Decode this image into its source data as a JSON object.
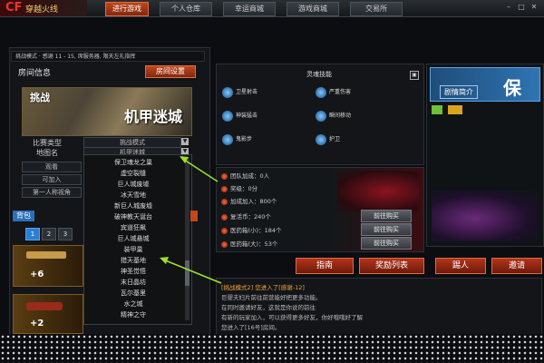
{
  "app": {
    "logo_short": "CF",
    "logo_text": "穿越火线"
  },
  "nav": {
    "tabs": [
      {
        "label": "进行游戏",
        "active": true
      },
      {
        "label": "个人仓库",
        "active": false
      },
      {
        "label": "幸运商城",
        "active": false
      },
      {
        "label": "游戏商城",
        "active": false
      },
      {
        "label": "交易所",
        "active": false
      }
    ]
  },
  "strip_text": "挑战模式 · 感谢 11 - 15, 席服务器, 限天左礼指挥",
  "room": {
    "title": "房间信息",
    "settings_button": "房间设置",
    "map_mode_caption": "挑战",
    "map_name_caption": "机甲迷城",
    "rows": [
      {
        "label": "比赛类型",
        "value": "挑战模式"
      },
      {
        "label": "地图名",
        "value": "机甲迷城"
      }
    ],
    "short_rows": [
      "观看",
      "可加入",
      "第一人称视角"
    ]
  },
  "dropdown": {
    "items": [
      "保卫魂龙之巢",
      "虚空裂缝",
      "巨人城废墟",
      "冰天雪地",
      "新巨人城废墟",
      "破神教天诞台",
      "宾道狂飙",
      "巨人城悬城",
      "装甲巢",
      "猎天基地",
      "神圣觉悟",
      "末日晶坊",
      "瓦尔基里",
      "水之城",
      "精神之守"
    ]
  },
  "backpack": {
    "tab": "背包",
    "pages": [
      "1",
      "2",
      "3"
    ],
    "weapons": [
      {
        "bonus": "+6"
      },
      {
        "bonus": "+2"
      }
    ]
  },
  "skills_panel": {
    "title": "灵魂技能",
    "skills": [
      {
        "label": "卫星射击",
        "icon": "satellite-icon"
      },
      {
        "label": "严重伤害",
        "icon": "damage-icon"
      },
      {
        "label": "神装猛击",
        "icon": "strike-icon"
      },
      {
        "label": "瞬间移动",
        "icon": "teleport-icon"
      },
      {
        "label": "鬼影步",
        "icon": "ghost-icon"
      },
      {
        "label": "护卫",
        "icon": "guard-icon"
      }
    ]
  },
  "stats": [
    {
      "text": "团队加成：0人",
      "button": ""
    },
    {
      "text": "奖级：0分",
      "button": ""
    },
    {
      "text": "加成加入：800个",
      "button": ""
    },
    {
      "text": "复活币：240个",
      "button": "前往购买"
    },
    {
      "text": "医药箱(小)：184个",
      "button": "前往购买"
    },
    {
      "text": "医药箱(大)：53个",
      "button": "前往购买"
    }
  ],
  "right_card": {
    "tab": "剧情简介",
    "big_text": "保"
  },
  "action_buttons": [
    "指南",
    "奖励列表",
    "踢人",
    "邀请"
  ],
  "chat": [
    {
      "text": "[挑战模式2] 您进入了[感谢-12]",
      "highlight": true
    },
    {
      "text": "巨婴夫妇片前往前营能好把更多功能。",
      "highlight": false
    },
    {
      "text": "在同时邀请好友，这就是你说的前往",
      "highlight": false
    },
    {
      "text": "有新的玩家加入，可以获得更多好友，你好哦哦好了解",
      "highlight": false
    },
    {
      "text": "您进入了[16号]房间。",
      "highlight": false
    }
  ],
  "colors": {
    "accent": "#c2461a",
    "guide_arrow": "#9be12c",
    "blue_tag": "#2a6fb8"
  }
}
